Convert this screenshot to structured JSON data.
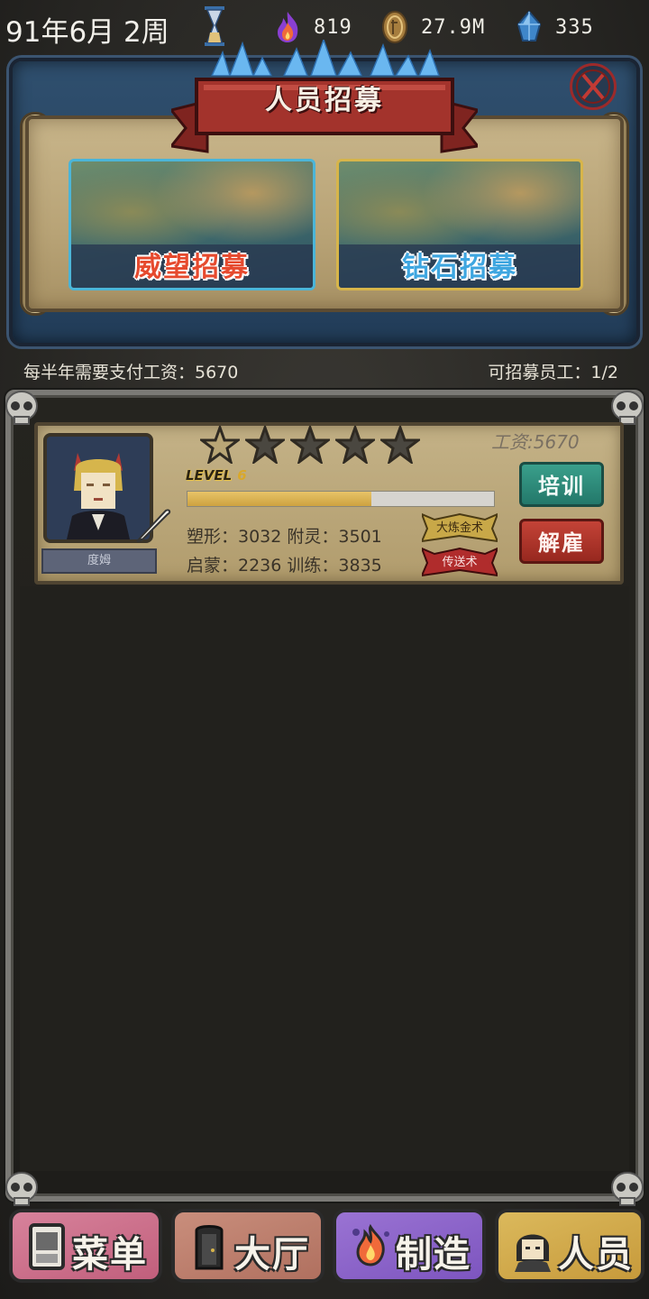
{
  "status_bar": {
    "date": "91年6月 2周",
    "flame": "819",
    "coins": "27.9M",
    "gems": "335"
  },
  "recruit": {
    "title": "人员招募",
    "prestige_label": "威望招募",
    "diamond_label": "钻石招募"
  },
  "info": {
    "wage_line": "每半年需要支付工资：5670",
    "capacity_line": "可招募员工：1/2"
  },
  "staff": [
    {
      "name": "度姆",
      "wage": "工资:5670",
      "stars_filled": 1,
      "stars_total": 5,
      "level_word": "LEVEL",
      "level": "6",
      "level_progress": 0.6,
      "stat_line_1": "塑形：3032 附灵：3501",
      "stat_line_2": "启蒙：2236 训练：3835",
      "skill_1": "大炼金术",
      "skill_2": "传送术",
      "train_label": "培训",
      "fire_label": "解雇"
    }
  ],
  "nav": {
    "menu": "菜单",
    "hall": "大厅",
    "craft": "制造",
    "staff": "人员"
  },
  "colors": {
    "prestige_border": "#4bb5d8",
    "diamond_border": "#d7b54a",
    "train_btn": "#2f8c7a",
    "fire_btn": "#b3352b"
  }
}
